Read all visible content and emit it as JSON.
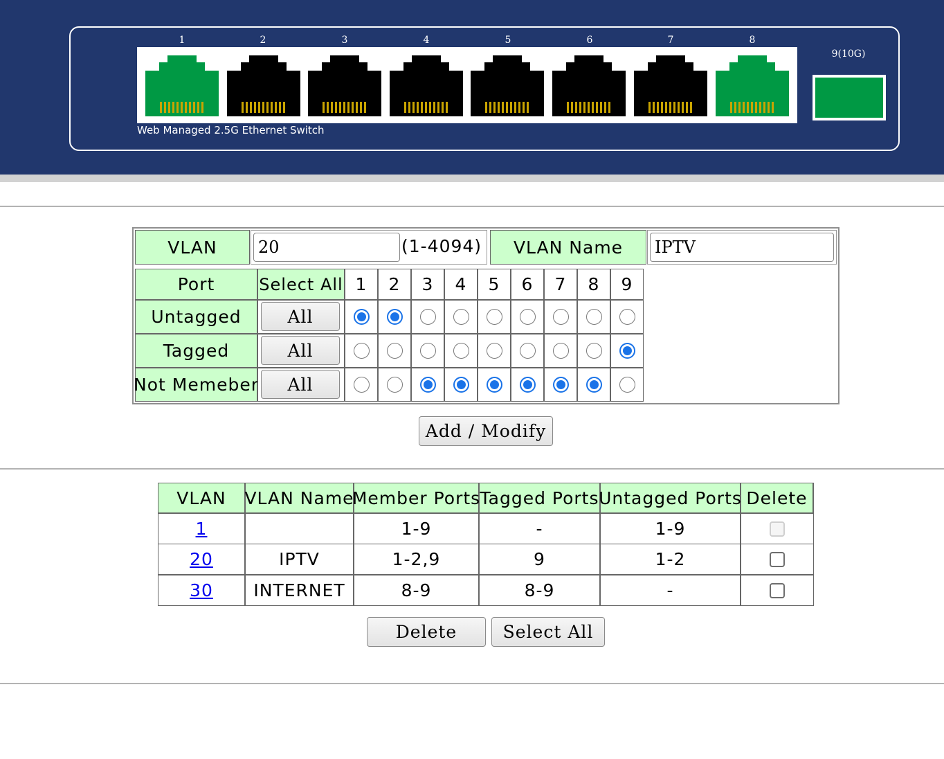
{
  "switch": {
    "product_label": "Web Managed 2.5G Ethernet Switch",
    "ports": [
      {
        "label": "1",
        "status": "link-up",
        "color": "#009944"
      },
      {
        "label": "2",
        "status": "link-down",
        "color": "#000000"
      },
      {
        "label": "3",
        "status": "link-down",
        "color": "#000000"
      },
      {
        "label": "4",
        "status": "link-down",
        "color": "#000000"
      },
      {
        "label": "5",
        "status": "link-down",
        "color": "#000000"
      },
      {
        "label": "6",
        "status": "link-down",
        "color": "#000000"
      },
      {
        "label": "7",
        "status": "link-down",
        "color": "#000000"
      },
      {
        "label": "8",
        "status": "link-up",
        "color": "#009944"
      }
    ],
    "sfp": {
      "label": "9(10G)",
      "status": "link-up",
      "color": "#009944"
    }
  },
  "vlan_form": {
    "vlan_label": "VLAN",
    "vlan_value": "20",
    "vlan_range": "(1-4094)",
    "name_label": "VLAN Name",
    "name_value": "IPTV",
    "port_header": "Port",
    "select_all_header": "Select All",
    "port_numbers": [
      "1",
      "2",
      "3",
      "4",
      "5",
      "6",
      "7",
      "8",
      "9"
    ],
    "rows": [
      {
        "label": "Untagged",
        "all_button": "All",
        "selected": [
          true,
          true,
          false,
          false,
          false,
          false,
          false,
          false,
          false
        ]
      },
      {
        "label": "Tagged",
        "all_button": "All",
        "selected": [
          false,
          false,
          false,
          false,
          false,
          false,
          false,
          false,
          true
        ]
      },
      {
        "label": "Not Memeber",
        "all_button": "All",
        "selected": [
          false,
          false,
          true,
          true,
          true,
          true,
          true,
          true,
          false
        ]
      }
    ],
    "submit_button": "Add / Modify"
  },
  "vlan_table": {
    "headers": [
      "VLAN",
      "VLAN Name",
      "Member Ports",
      "Tagged Ports",
      "Untagged Ports",
      "Delete"
    ],
    "rows": [
      {
        "vlan": "1",
        "name": "",
        "member": "1-9",
        "tagged": "-",
        "untagged": "1-9",
        "delete_disabled": true
      },
      {
        "vlan": "20",
        "name": "IPTV",
        "member": "1-2,9",
        "tagged": "9",
        "untagged": "1-2",
        "delete_disabled": false
      },
      {
        "vlan": "30",
        "name": "INTERNET",
        "member": "8-9",
        "tagged": "8-9",
        "untagged": "-",
        "delete_disabled": false
      }
    ],
    "delete_button": "Delete",
    "select_all_button": "Select All"
  },
  "colors": {
    "header_bg": "#21376d",
    "table_header_bg": "#ccffcc",
    "radio_selected": "#1a73e8",
    "link_up": "#009944"
  }
}
